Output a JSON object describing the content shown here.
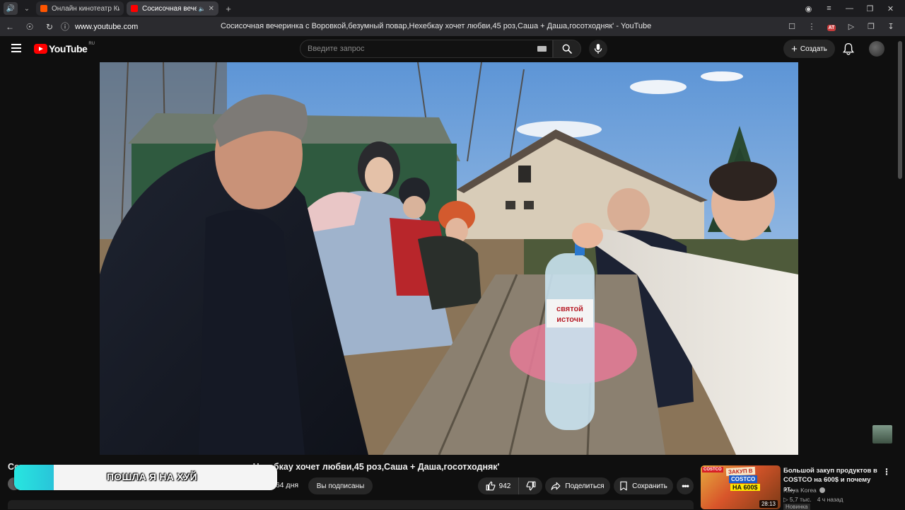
{
  "browser": {
    "tabs": [
      {
        "label": "Онлайн кинотеатр Кинопоиск",
        "favicon_color": "#ff5500",
        "active": false
      },
      {
        "label": "Сосисочная вечеринка",
        "favicon_color": "#ff0000",
        "active": true
      }
    ],
    "new_tab": "+",
    "url": "www.youtube.com",
    "page_title": "Сосисочная вечеринка с Воровкой,безумный повар,Нехебкау хочет любви,45 роз,Саша + Даша,госотходняк' - YouTube",
    "at_badge": "AT"
  },
  "header": {
    "logo_text": "YouTube",
    "logo_region": "RU",
    "search_placeholder": "Введите запрос",
    "create_label": "Создать"
  },
  "video": {
    "title_visible_end": "Нехебкау хочет любви,45 роз,Саша + Даша,госотходняк'",
    "title_visible_start": "Со",
    "subscribers_suffix": "364 дня",
    "bottle_label": "святой источник"
  },
  "actions": {
    "subscribed_label": "Вы подписаны",
    "likes": "942",
    "share_label": "Поделиться",
    "save_label": "Сохранить"
  },
  "overlay": {
    "text": "ПОШЛА Я НА ХУЙ",
    "progress": 0.15,
    "bar_color": "#27e6e0"
  },
  "recommendation": {
    "title": "Большой закуп продуктов в COSTCO на 600$ и почему эт...",
    "channel": "Katya Korea",
    "views": "5,7 тыс.",
    "age": "4 ч назад",
    "duration": "28:13",
    "thumb_brand": "COSTCO",
    "thumb_line1": "ЗАКУП В",
    "thumb_line2": "COSTCO",
    "thumb_line3": "НА 600$",
    "next_label": "Новинка"
  }
}
